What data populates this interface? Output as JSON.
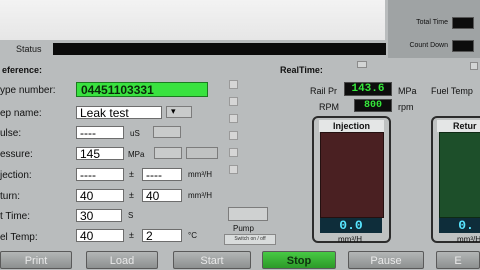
{
  "time_panel": {
    "total_time_label": "Total Time",
    "count_down_label": "Count Down"
  },
  "status": {
    "label": "Status"
  },
  "left_panel": {
    "header": "eference:",
    "rows": {
      "type_number": {
        "label": "ype number:",
        "value": "04451103331"
      },
      "step_name": {
        "label": "ep name:",
        "value": "Leak test"
      },
      "pulse": {
        "label": "ulse:",
        "value": "----",
        "unit": "uS"
      },
      "pressure": {
        "label": "essure:",
        "value": "145",
        "unit": "MPa"
      },
      "injection": {
        "label": "jection:",
        "value": "----",
        "sep": "±",
        "value2": "----",
        "unit": "mm³/H"
      },
      "return": {
        "label": "turn:",
        "value": "40",
        "sep": "±",
        "value2": "40",
        "unit": "mm³/H"
      },
      "test_time": {
        "label": "t Time:",
        "value": "30",
        "unit": "S"
      },
      "fuel_temp": {
        "label": "el Temp:",
        "value": "40",
        "sep": "±",
        "value2": "2",
        "unit": "°C"
      }
    },
    "pump_label": "Pump",
    "pump_sub": "Switch on / off"
  },
  "realtime": {
    "header": "RealTime:",
    "rail_pr_label": "Rail Pr",
    "rail_pr_value": "143.6",
    "rail_pr_unit": "MPa",
    "rpm_label": "RPM",
    "rpm_value": "800",
    "rpm_unit": "rpm",
    "fuel_temp_label": "Fuel Temp",
    "injection": {
      "title": "Injection",
      "value": "0.0",
      "unit": "mm³/H"
    },
    "return": {
      "title": "Retur",
      "value": "0.",
      "unit": "mm³/H"
    }
  },
  "buttons": {
    "print": "Print",
    "load": "Load",
    "start": "Start",
    "stop": "Stop",
    "pause": "Pause",
    "exit": "E"
  },
  "colors": {
    "accent_green": "#39e23f",
    "stop_green": "#2c9a29",
    "injection_fill": "#4a2022",
    "return_fill": "#1d4f2a"
  }
}
